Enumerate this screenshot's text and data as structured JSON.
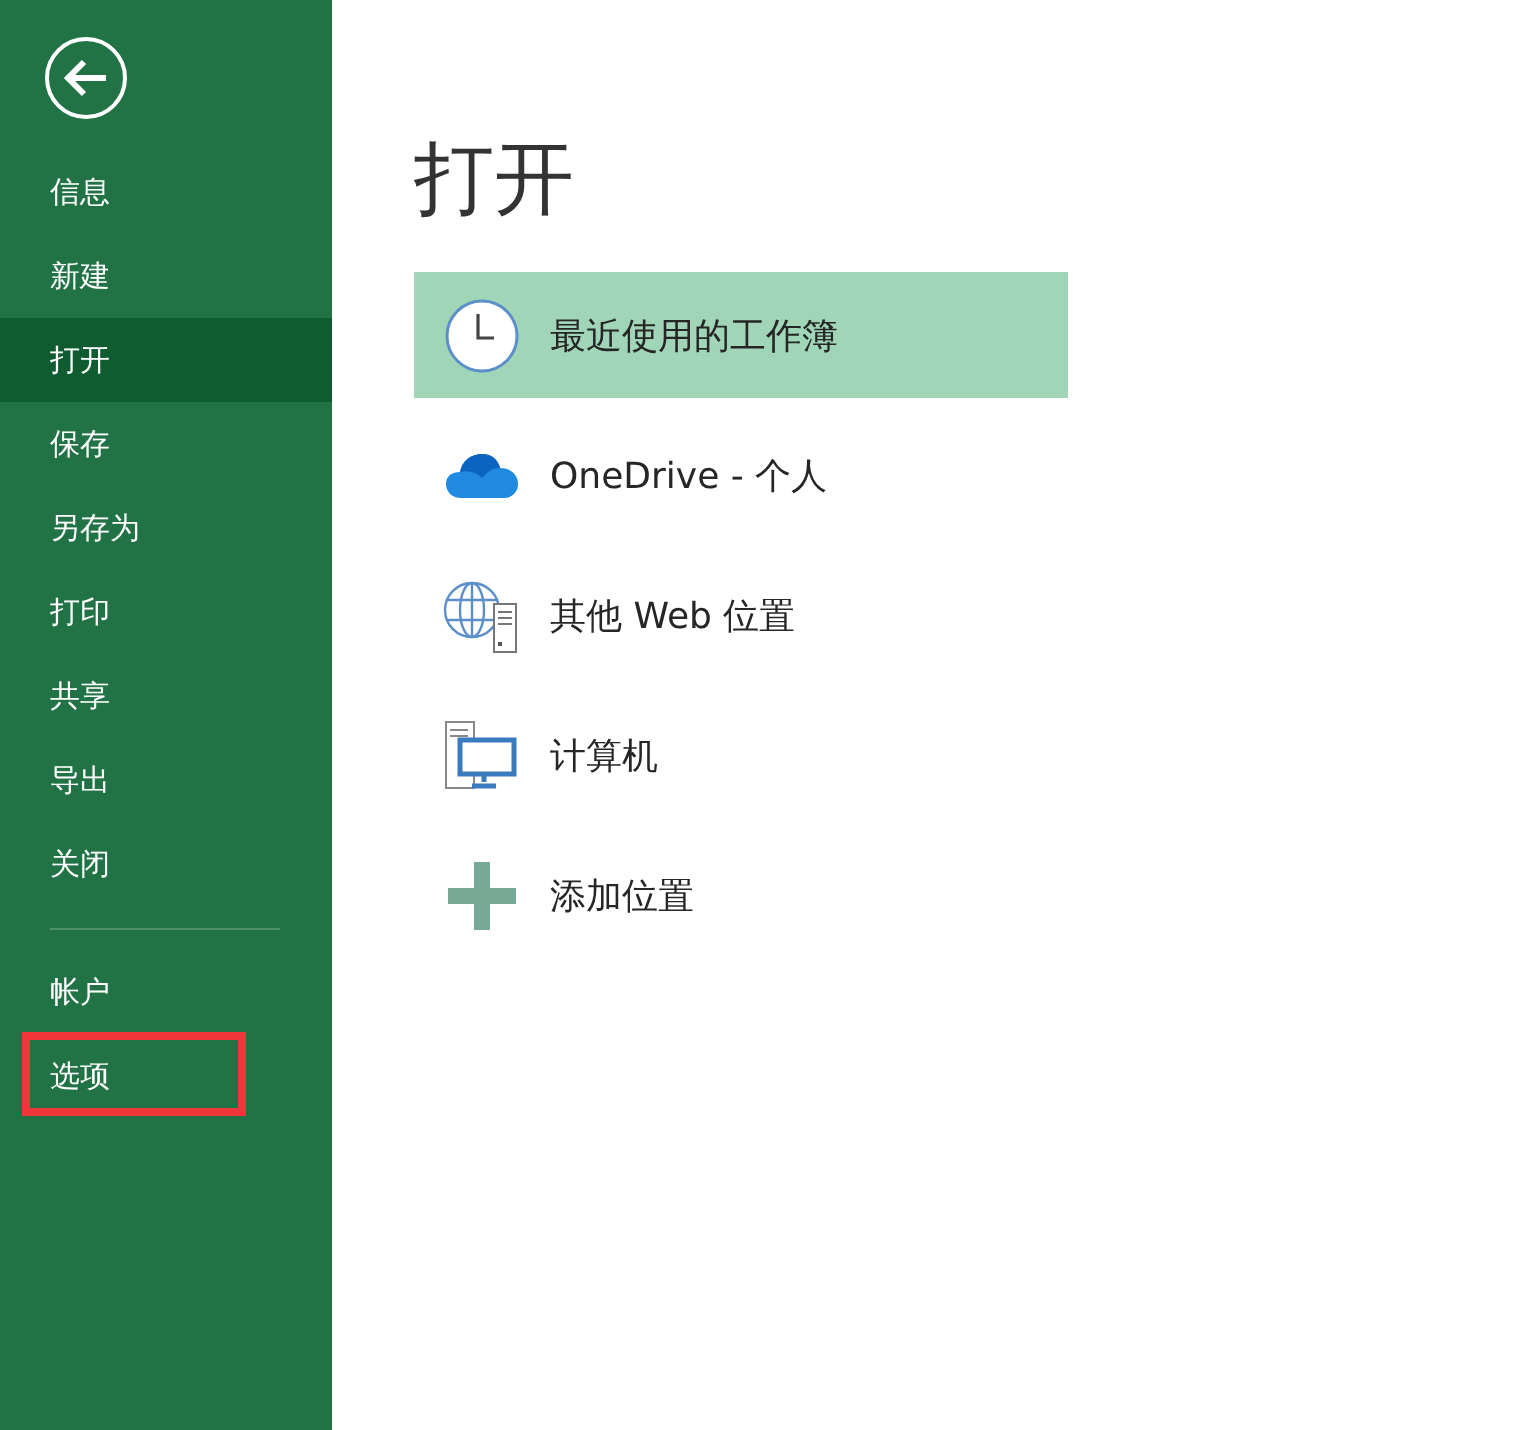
{
  "sidebar": {
    "items": [
      {
        "label": "信息",
        "selected": false,
        "highlighted": false
      },
      {
        "label": "新建",
        "selected": false,
        "highlighted": false
      },
      {
        "label": "打开",
        "selected": true,
        "highlighted": false
      },
      {
        "label": "保存",
        "selected": false,
        "highlighted": false
      },
      {
        "label": "另存为",
        "selected": false,
        "highlighted": false
      },
      {
        "label": "打印",
        "selected": false,
        "highlighted": false
      },
      {
        "label": "共享",
        "selected": false,
        "highlighted": false
      },
      {
        "label": "导出",
        "selected": false,
        "highlighted": false
      },
      {
        "label": "关闭",
        "selected": false,
        "highlighted": false
      }
    ],
    "footer_items": [
      {
        "label": "帐户",
        "selected": false,
        "highlighted": false
      },
      {
        "label": "选项",
        "selected": false,
        "highlighted": true
      }
    ]
  },
  "main": {
    "title": "打开",
    "places": [
      {
        "kind": "recent",
        "label": "最近使用的工作簿",
        "selected": true
      },
      {
        "kind": "onedrive",
        "label": "OneDrive - 个人",
        "selected": false
      },
      {
        "kind": "web",
        "label": "其他 Web 位置",
        "selected": false
      },
      {
        "kind": "computer",
        "label": "计算机",
        "selected": false
      },
      {
        "kind": "add",
        "label": "添加位置",
        "selected": false
      }
    ]
  }
}
